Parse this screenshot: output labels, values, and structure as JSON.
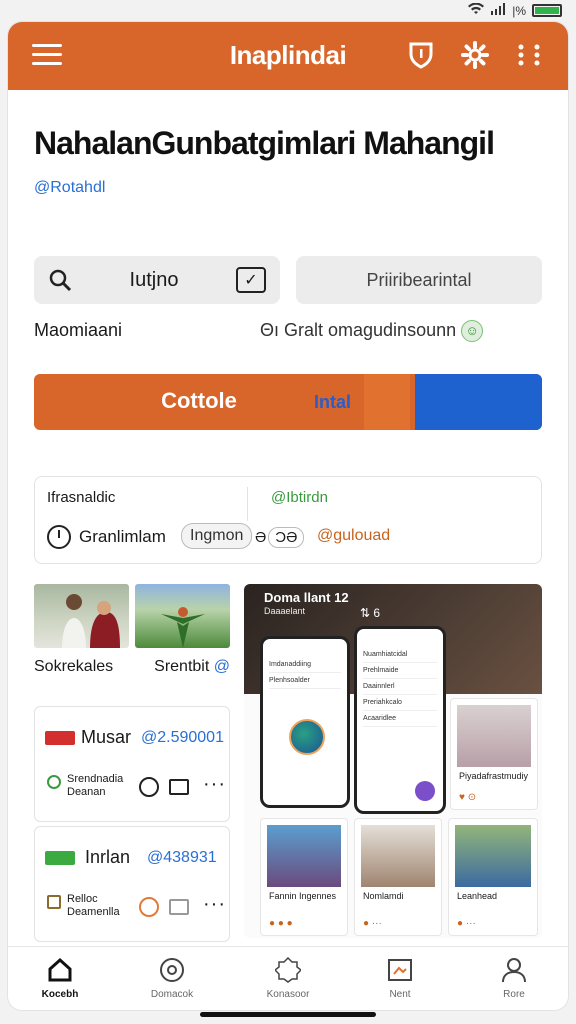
{
  "status": {
    "signal": "|%"
  },
  "topbar": {
    "title": "Inaplindai"
  },
  "hero": {
    "title": "NahalanGunbatgimlari Mahangil",
    "handle": "@Rotahdl"
  },
  "search": {
    "text": "Iutjno"
  },
  "pill": {
    "label": "Priiribearintal"
  },
  "meta": {
    "left": "Maomiaani",
    "right": "Θı Gralt omagudinsounn"
  },
  "progress": {
    "label": "Cottole",
    "label2": "Intal",
    "fill_fraction": 0.25,
    "fill_color": "#1e62d0",
    "bar_color": "#d8662a"
  },
  "info": {
    "a": "Ifrasnaldic",
    "b": "@Ibtirdn",
    "c": "Granlimlam",
    "tag": "Ingmon",
    "d1": "Ə",
    "d2": "ϽƏ",
    "e": "@gulouad"
  },
  "left": {
    "caption1": "Sokrekales",
    "caption2": "Srentbit",
    "caption2_at": "@",
    "card1": {
      "name": "Musar",
      "num": "@2.590001",
      "line1": "Srendnadia",
      "line2": "Deanan"
    },
    "card2": {
      "name": "Inrlan",
      "num": "@438931",
      "line1": "Relloc",
      "line2": "Deamenlla"
    }
  },
  "gallery": {
    "title": "Doma llant",
    "num": "12",
    "subtitle": "Daaaelant",
    "icons": "⇅ 6",
    "list": [
      "Imdanaddiing",
      "Plenhsoalder",
      "Nuamhiatcidal",
      "Prehlmaide",
      "Daainnlerl",
      "Preriahkcalo",
      "Acaaridlee"
    ],
    "t1": "Piyadafrastmudiy",
    "t2": "Fannin Ingennes",
    "t3": "Nomlamdi",
    "t4": "Leanhead"
  },
  "nav": {
    "home": "Kocebh",
    "n2": "Domacok",
    "n3": "Konasoor",
    "n4": "Nent",
    "n5": "Rore"
  }
}
